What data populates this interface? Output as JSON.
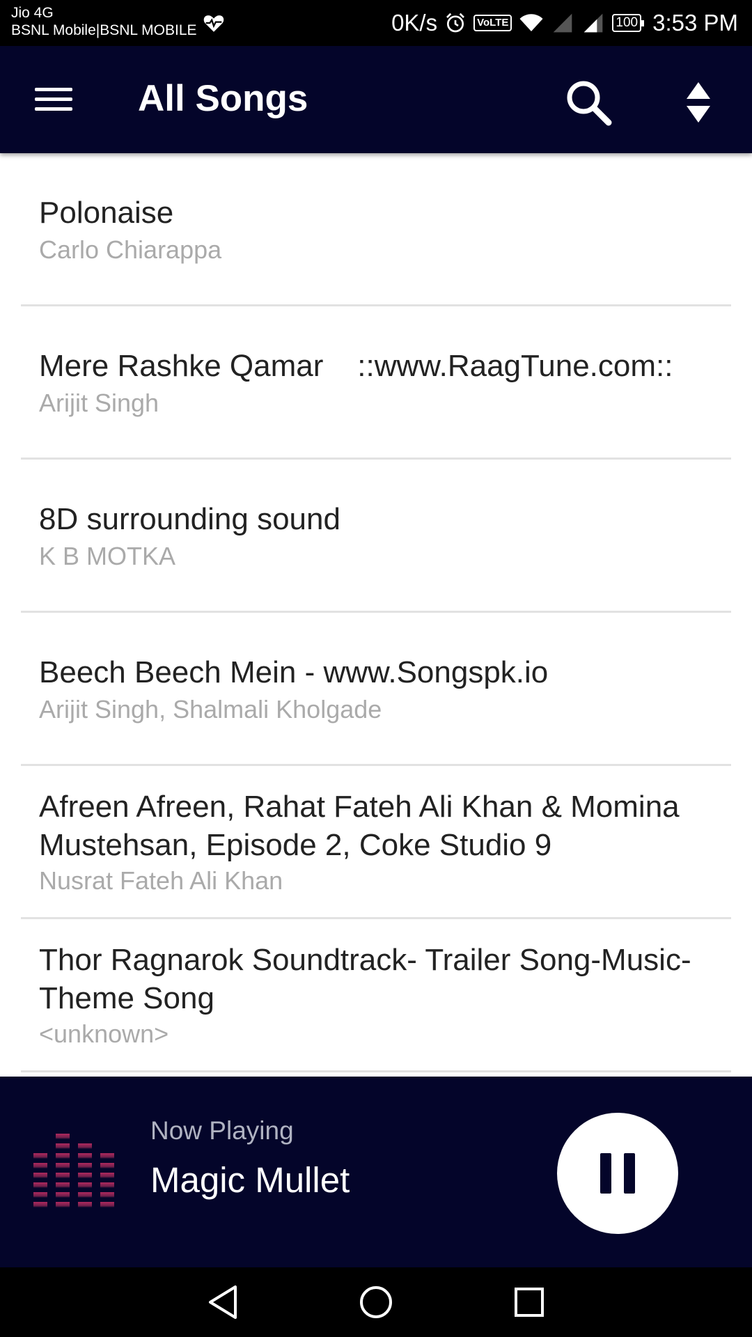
{
  "status_bar": {
    "carrier_line1": "Jio 4G",
    "carrier_line2": "BSNL Mobile|BSNL MOBILE",
    "net_speed": "0K/s",
    "volte": "VoLTE",
    "battery": "100",
    "time": "3:53 PM"
  },
  "app_bar": {
    "title": "All Songs",
    "icons": [
      "menu-icon",
      "search-icon",
      "sort-icon"
    ],
    "background": "#04052a"
  },
  "songs": [
    {
      "title": "Polonaise",
      "artist": "Carlo Chiarappa"
    },
    {
      "title": "Mere Rashke Qamar    ::www.RaagTune.com::",
      "artist": "Arijit Singh"
    },
    {
      "title": "8D surrounding sound",
      "artist": "K B MOTKA"
    },
    {
      "title": "Beech Beech Mein - www.Songspk.io",
      "artist": "Arijit Singh, Shalmali Kholgade"
    },
    {
      "title": "Afreen Afreen, Rahat Fateh Ali Khan & Momina Mustehsan, Episode 2, Coke Studio 9",
      "artist": "Nusrat Fateh Ali Khan"
    },
    {
      "title": "Thor Ragnarok Soundtrack- Trailer Song-Music-Theme Song",
      "artist": "<unknown>"
    }
  ],
  "now_playing": {
    "label": "Now Playing",
    "title": "Magic Mullet",
    "icons": [
      "equalizer-icon",
      "pause-icon"
    ]
  },
  "nav_bar": {
    "icons": [
      "back-icon",
      "home-icon",
      "recents-icon"
    ]
  },
  "colors": {
    "accent": "#04052a",
    "title_text": "#222222",
    "artist_text": "#aaaaaa",
    "equalizer": "#b0295e"
  }
}
